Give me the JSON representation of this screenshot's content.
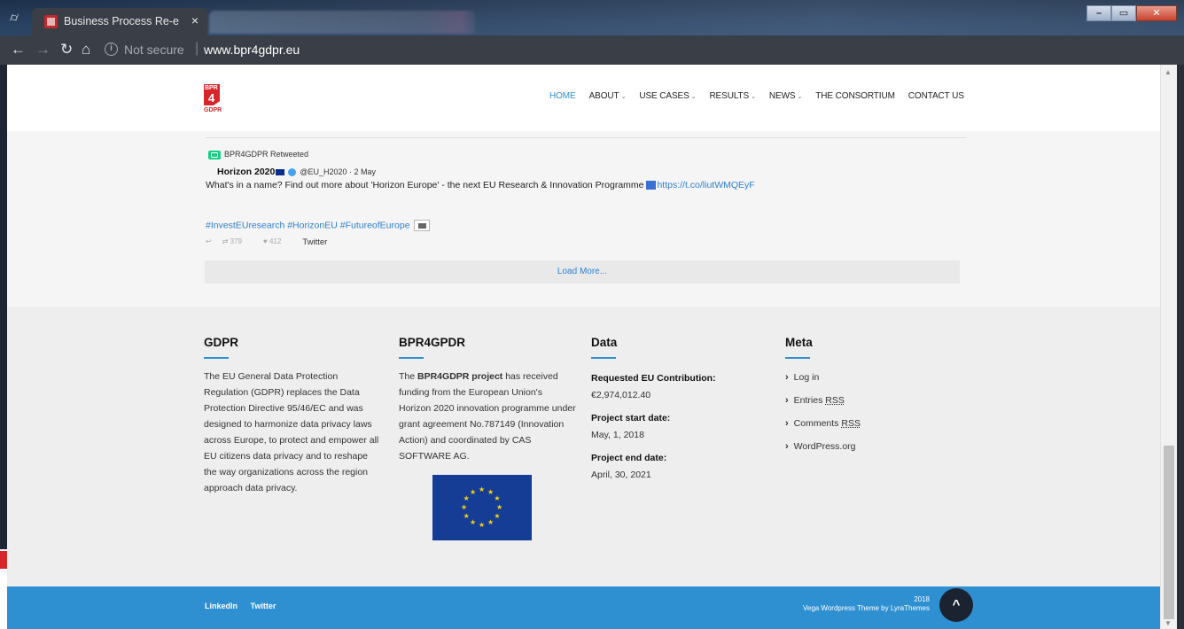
{
  "browser": {
    "tab_title": "Business Process Re-engi",
    "tab_close": "×",
    "security_label": "Not secure",
    "url": "www.bpr4gdpr.eu",
    "icons": [
      "incognito-icon",
      "back-icon",
      "forward-icon",
      "reload-icon",
      "home-icon",
      "info-icon",
      "zoom-icon",
      "star-icon",
      "menu-icon"
    ]
  },
  "header": {
    "logo_top": "BPR",
    "logo_mid": "4",
    "logo_bottom": "GDPR",
    "nav": [
      {
        "label": "HOME"
      },
      {
        "label": "ABOUT"
      },
      {
        "label": "USE CASES"
      },
      {
        "label": "RESULTS"
      },
      {
        "label": "NEWS"
      },
      {
        "label": "THE CONSORTIUM"
      },
      {
        "label": "CONTACT US"
      }
    ]
  },
  "tweet": {
    "retweet_label": "BPR4GDPR Retweeted",
    "author": "Horizon 2020",
    "handle": "@EU_H2020 · 2 May",
    "text": "What's in a name? Find out more about 'Horizon Europe' - the next EU Research & Innovation Programme ",
    "link": "https://t.co/liutWMQEyF",
    "hashtags": "#InvestEUresearch #HorizonEU #FutureofEurope",
    "retweets": "379",
    "likes": "412",
    "source": "Twitter"
  },
  "load_more": "Load More...",
  "footer": {
    "gdpr": {
      "title": "GDPR",
      "text": "The EU General Data Protection Regulation (GDPR) replaces the Data Protection Directive 95/46/EC and was designed to harmonize data privacy laws across Europe, to protect and empower all EU citizens data privacy and to reshape the way organizations across the region approach data privacy."
    },
    "bpr": {
      "title": "BPR4GPDR",
      "text_pre": "The ",
      "text_bold": "BPR4GDPR project",
      "text_post": " has received funding from the European Union's Horizon 2020 innovation programme under grant agreement No.787149 (Innovation Action) and coordinated by CAS SOFTWARE AG."
    },
    "data": {
      "title": "Data",
      "contribution_label": "Requested EU Contribution:",
      "contribution_value": "€2,974,012.40",
      "start_label": "Project start date:",
      "start_value": "May, 1, 2018",
      "end_label": "Project end date:",
      "end_value": "April, 30, 2021"
    },
    "meta": {
      "title": "Meta",
      "items": [
        {
          "pre": "Log in",
          "abbr": ""
        },
        {
          "pre": "Entries ",
          "abbr": "RSS"
        },
        {
          "pre": "Comments ",
          "abbr": "RSS"
        },
        {
          "pre": "WordPress.org",
          "abbr": ""
        }
      ]
    }
  },
  "bottom": {
    "linkedin": "LinkedIn",
    "twitter": "Twitter",
    "year": "2018",
    "credit": "Vega Wordpress Theme by LyraThemes",
    "to_top": "^"
  },
  "colors": {
    "accent": "#2e8fd1",
    "brand_red": "#d6262c",
    "eu_blue": "#163d96",
    "eu_yellow": "#f7d40a"
  }
}
